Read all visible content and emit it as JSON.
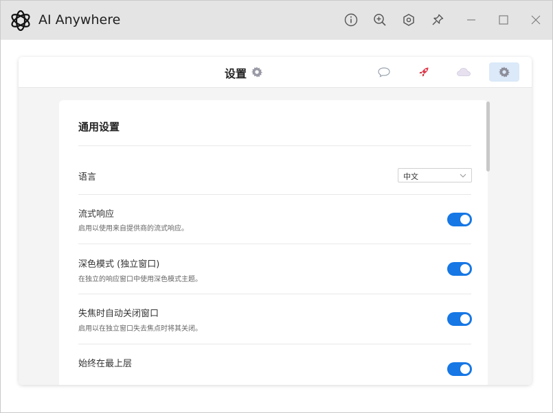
{
  "window": {
    "title": "AI Anywhere"
  },
  "titlebar_icons": [
    "info-icon",
    "zoom-in-icon",
    "hexagon-settings-icon",
    "pin-icon"
  ],
  "window_controls": [
    "minimize-icon",
    "maximize-icon",
    "close-icon"
  ],
  "header": {
    "title": "设置",
    "nav": [
      {
        "icon": "chat-bubble-icon",
        "active": false
      },
      {
        "icon": "rocket-icon",
        "active": false
      },
      {
        "icon": "cloud-icon",
        "active": false
      },
      {
        "icon": "gear-icon",
        "active": true
      }
    ]
  },
  "settings": {
    "section_title": "通用设置",
    "language": {
      "label": "语言",
      "value": "中文"
    },
    "rows": [
      {
        "label": "流式响应",
        "desc": "启用以使用来自提供商的流式响应。",
        "enabled": true
      },
      {
        "label": "深色模式 (独立窗口)",
        "desc": "在独立的响应窗口中使用深色模式主题。",
        "enabled": true
      },
      {
        "label": "失焦时自动关闭窗口",
        "desc": "启用以在独立窗口失去焦点时将其关闭。",
        "enabled": true
      },
      {
        "label": "始终在最上层",
        "desc": "",
        "enabled": true
      }
    ]
  },
  "colors": {
    "accent": "#1677e5",
    "titlebar": "#e4e4e4",
    "active_nav": "#dbe9f8"
  }
}
